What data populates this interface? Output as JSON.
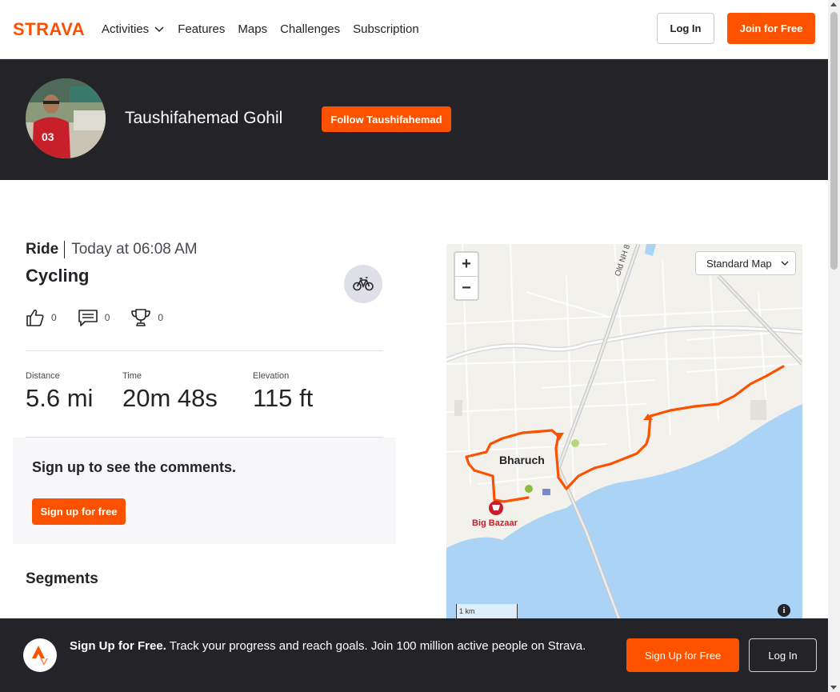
{
  "nav": {
    "logo_text": "STRAVA",
    "items": [
      {
        "label": "Activities",
        "has_dropdown": true
      },
      {
        "label": "Features"
      },
      {
        "label": "Maps"
      },
      {
        "label": "Challenges"
      },
      {
        "label": "Subscription"
      }
    ],
    "login_label": "Log In",
    "join_label": "Join for Free"
  },
  "athlete": {
    "name": "Taushifahemad Gohil",
    "follow_label": "Follow Taushifahemad"
  },
  "activity": {
    "type": "Ride",
    "date": "Today at 06:08 AM",
    "title": "Cycling",
    "sport_icon": "bike-icon",
    "kudos_count": "0",
    "comments_count": "0",
    "achievements_count": "0",
    "stats": [
      {
        "label": "Distance",
        "value": "5.6 mi"
      },
      {
        "label": "Time",
        "value": "20m 48s"
      },
      {
        "label": "Elevation",
        "value": "115 ft"
      }
    ]
  },
  "comments": {
    "title": "Sign up to see the comments.",
    "signup_label": "Sign up for free"
  },
  "segments": {
    "title": "Segments"
  },
  "map": {
    "zoom_in": "+",
    "zoom_out": "−",
    "style_select": "Standard Map",
    "road_label": "Old NH 8",
    "city_label": "Bharuch",
    "poi_label": "Big Bazaar",
    "scale_label": "1 km",
    "info_label": "i",
    "route_color": "#fc5200"
  },
  "bottom_bar": {
    "headline": "Sign Up for Free.",
    "text": "Track your progress and reach goals. Join 100 million active people on Strava.",
    "signup_label": "Sign Up for Free",
    "login_label": "Log In"
  },
  "colors": {
    "brand": "#fc5200",
    "dark": "#242428",
    "water": "#aad3f5"
  }
}
